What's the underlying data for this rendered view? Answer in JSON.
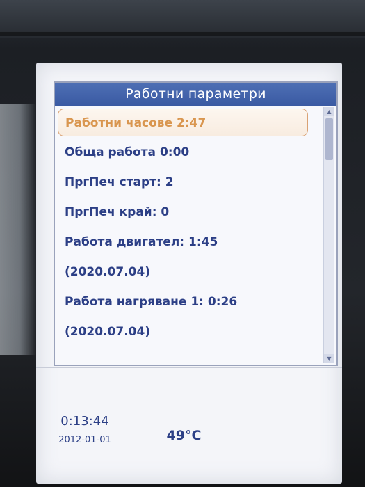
{
  "panel": {
    "title": "Работни параметри"
  },
  "list": {
    "items": [
      "Работни часове 2:47",
      "Обща работа 0:00",
      "ПргПеч старт: 2",
      "ПргПеч край: 0",
      "Работа двигател: 1:45",
      "(2020.07.04)",
      "Работа нагряване 1: 0:26",
      "(2020.07.04)"
    ],
    "selected_index": 0
  },
  "status": {
    "time": "0:13:44",
    "date": "2012-01-01",
    "temperature": "49°C"
  },
  "colors": {
    "title_bar": "#3a5aa3",
    "text": "#2c3f86",
    "selected_text": "#d9964f",
    "selected_border": "#d9a274"
  },
  "icons": {
    "scroll_up": "triangle-up-icon",
    "scroll_down": "triangle-down-icon"
  }
}
